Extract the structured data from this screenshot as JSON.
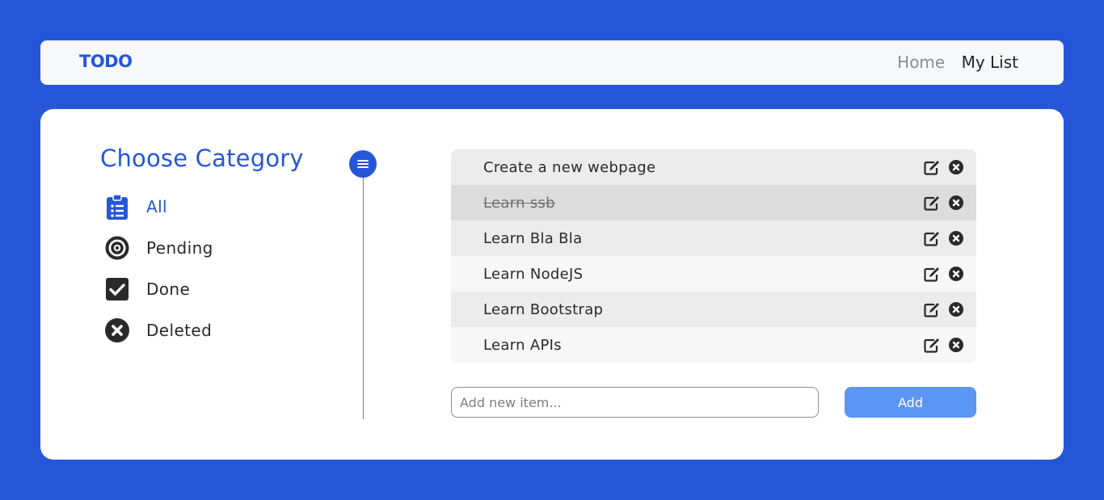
{
  "navbar": {
    "brand": "TODO",
    "links": [
      "Home",
      "My List"
    ]
  },
  "categories": {
    "title": "Choose Category",
    "items": [
      {
        "label": "All",
        "icon": "clipboard-list-icon",
        "active": true
      },
      {
        "label": "Pending",
        "icon": "bullseye-icon",
        "active": false
      },
      {
        "label": "Done",
        "icon": "check-square-icon",
        "active": false
      },
      {
        "label": "Deleted",
        "icon": "times-circle-icon",
        "active": false
      }
    ]
  },
  "todos": [
    {
      "text": "Create a new webpage",
      "done": false
    },
    {
      "text": "Learn ssb",
      "done": true
    },
    {
      "text": "Learn Bla Bla",
      "done": false
    },
    {
      "text": "Learn NodeJS",
      "done": false
    },
    {
      "text": "Learn Bootstrap",
      "done": false
    },
    {
      "text": "Learn APIs",
      "done": false
    }
  ],
  "form": {
    "placeholder": "Add new item...",
    "value": "",
    "add_label": "Add"
  },
  "colors": {
    "accent": "#2656d8",
    "button": "#5b95f5",
    "background": "#2656d8"
  }
}
